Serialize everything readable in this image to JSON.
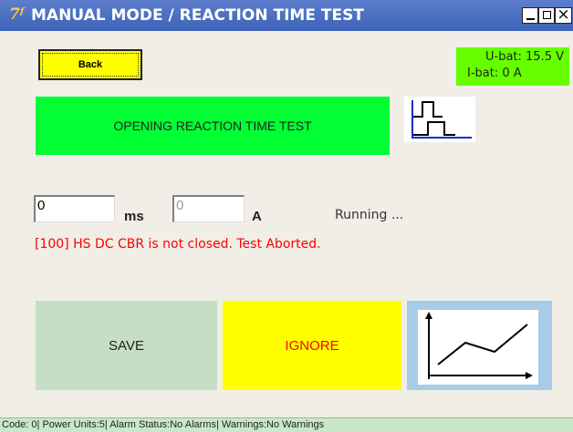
{
  "window": {
    "app_icon_glyph": "7ᶠ",
    "title": "MANUAL MODE / REACTION TIME TEST",
    "close_glyph": "×"
  },
  "toolbar": {
    "back_label": "Back"
  },
  "battery": {
    "voltage": "U-bat: 15.5 V",
    "current": "I-bat: 0 A",
    "color": "#66ff00"
  },
  "test": {
    "type_label": "OPENING REACTION TIME TEST",
    "banner_color": "#00ff33",
    "timing_icon": "timing-diagram-icon"
  },
  "measurement": {
    "time_value": "0",
    "time_unit": "ms",
    "current_value": "0",
    "current_unit": "A",
    "status": "Running ..."
  },
  "error_message": "[100] HS DC CBR is not closed. Test Aborted.",
  "actions": {
    "save_label": "SAVE",
    "ignore_label": "IGNORE",
    "graph_icon": "line-chart-icon"
  },
  "statusbar": {
    "text": "Code: 0| Power Units:5| Alarm Status:No Alarms| Warnings:No Warnings"
  }
}
